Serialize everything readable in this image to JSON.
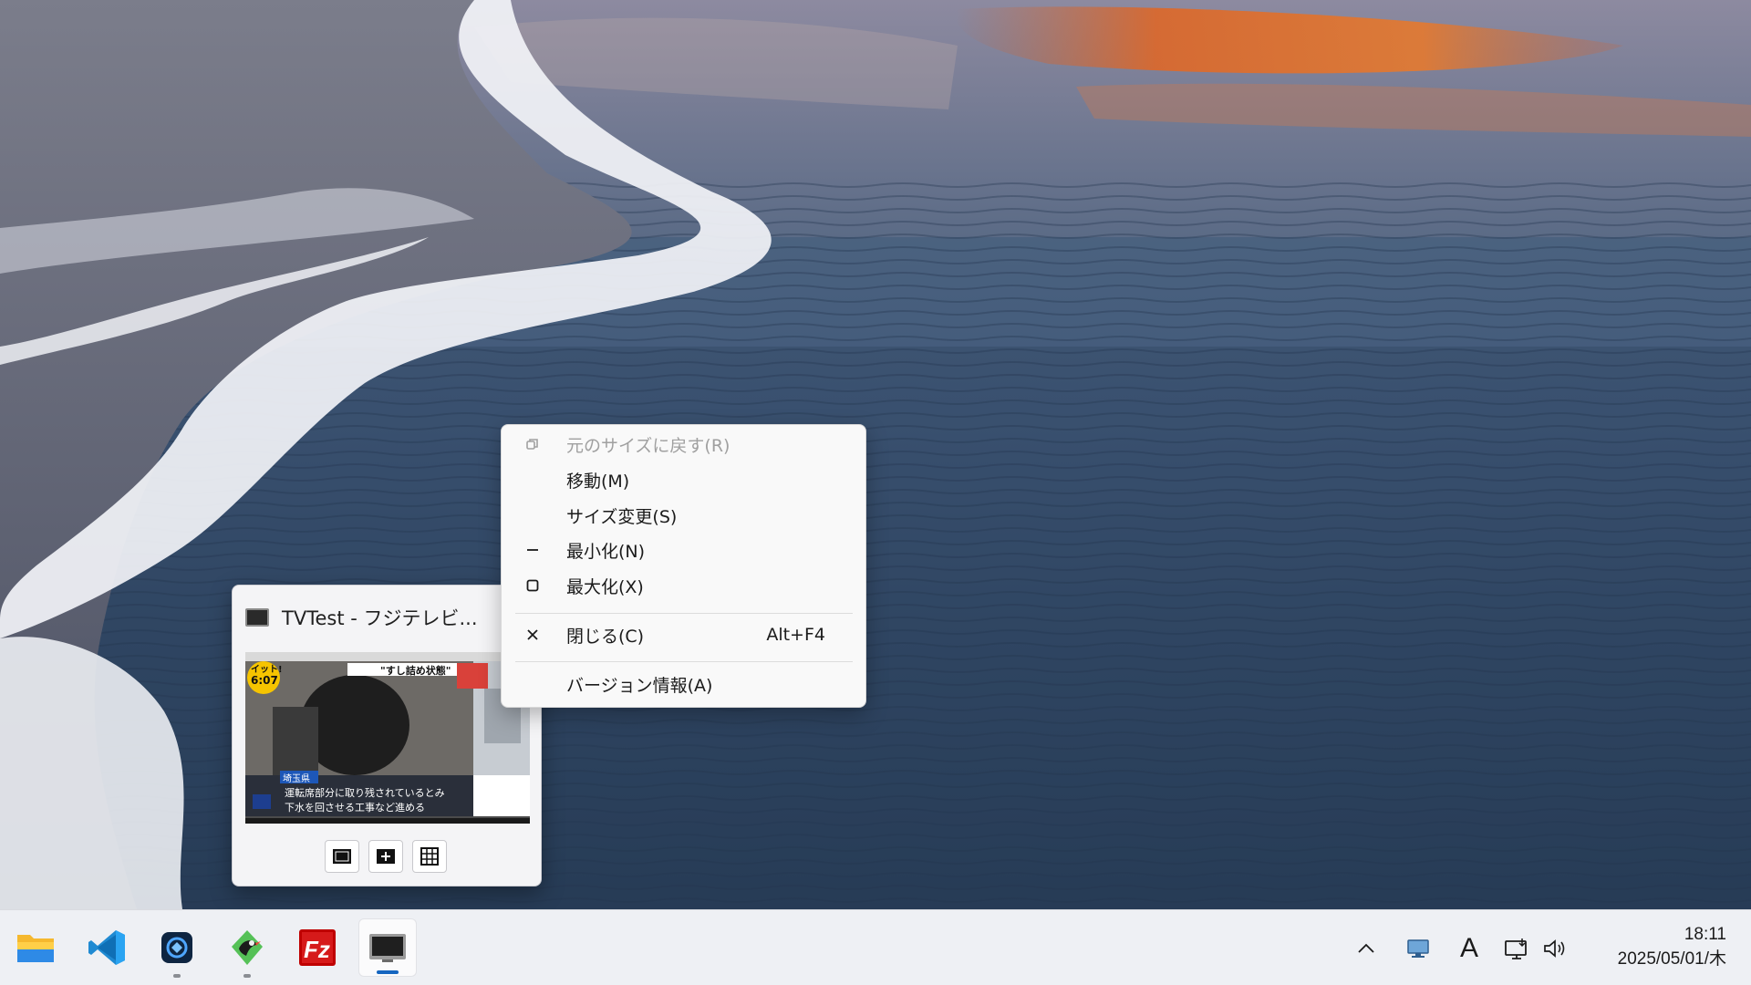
{
  "preview": {
    "title": "TVTest - フジテレビ...",
    "thumbnail": {
      "corner_badge": "イット!",
      "corner_time": "6:07",
      "headline_top": "\"すし詰め状態\"",
      "location_tag": "埼玉県",
      "caption_line1": "運転席部分に取り残されているとみ",
      "caption_line2": "下水を回させる工事など進める"
    },
    "controls": [
      "fullscreen-icon",
      "picture-in-picture-icon",
      "grid-icon"
    ]
  },
  "context_menu": {
    "items": [
      {
        "label": "元のサイズに戻す(R)",
        "icon": "restore-icon",
        "disabled": true
      },
      {
        "label": "移動(M)",
        "icon": "",
        "disabled": false
      },
      {
        "label": "サイズ変更(S)",
        "icon": "",
        "disabled": false
      },
      {
        "label": "最小化(N)",
        "icon": "minimize-icon",
        "disabled": false
      },
      {
        "label": "最大化(X)",
        "icon": "maximize-icon",
        "disabled": false
      },
      {
        "label": "閉じる(C)",
        "icon": "close-icon",
        "shortcut": "Alt+F4",
        "disabled": false
      },
      {
        "label": "バージョン情報(A)",
        "icon": "",
        "disabled": false
      }
    ]
  },
  "taskbar": {
    "apps": [
      {
        "name": "file-explorer-icon",
        "running": false
      },
      {
        "name": "vscode-icon",
        "running": false
      },
      {
        "name": "app-blue-icon",
        "running": true
      },
      {
        "name": "app-bird-icon",
        "running": true
      },
      {
        "name": "filezilla-icon",
        "running": false
      },
      {
        "name": "tvtest-icon",
        "running": true,
        "active": true
      }
    ],
    "tray": {
      "chevron": "^",
      "ime": "A"
    },
    "clock": {
      "time": "18:11",
      "date": "2025/05/01/木"
    }
  },
  "colors": {
    "menu_bg": "#f9f9f9",
    "taskbar_bg": "#eef0f4",
    "accent": "#1566c0"
  }
}
